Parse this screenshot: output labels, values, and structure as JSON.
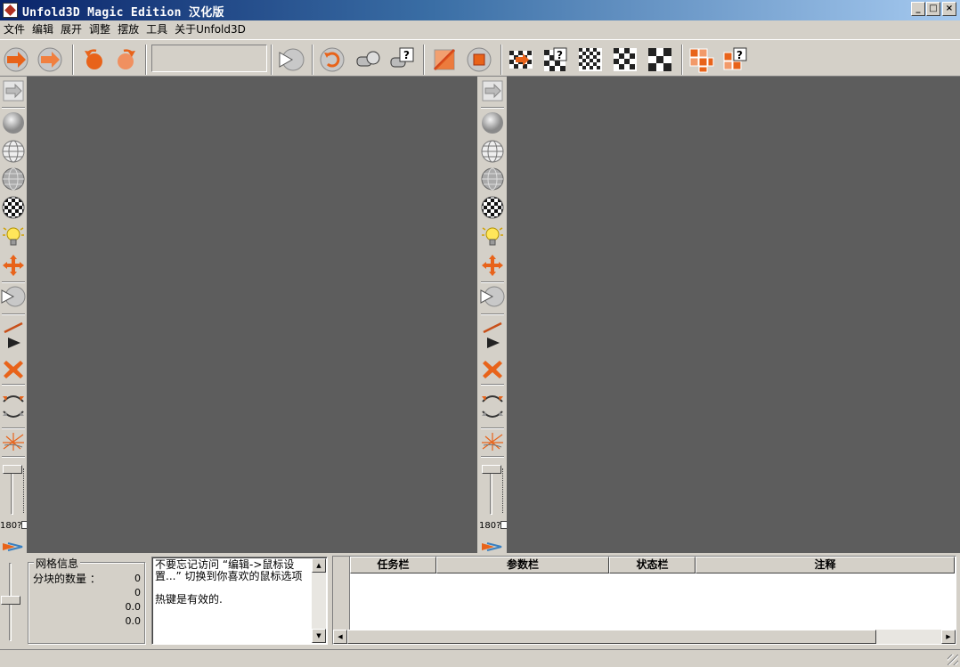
{
  "window": {
    "title": "Unfold3D Magic Edition 汉化版",
    "minimize_glyph": "_",
    "maximize_glyph": "□",
    "close_glyph": "×"
  },
  "menu": [
    "文件",
    "编辑",
    "展开",
    "调整",
    "摆放",
    "工具",
    "关于Unfold3D"
  ],
  "toolbar_icons": [
    "arrow-right-icon",
    "arrow-right-alt-icon",
    "rotate-left-icon",
    "rotate-right-icon",
    "cut-shape-icon",
    "undo-spiral-icon",
    "camera-icon",
    "help-camera-icon",
    "diagonal-square-icon",
    "stop-square-icon",
    "checker-arrow-icon",
    "checker-help-icon",
    "checker-small-icon",
    "checker-medium-icon",
    "checker-large-icon",
    "blocks-icon",
    "blocks-help-icon"
  ],
  "side_tools": {
    "angle_label": "180?",
    "icons": [
      "arrow-panel-icon",
      "sphere-icon",
      "wire-globe-icon",
      "globe-icon",
      "checker-sphere-icon",
      "light-bulb-icon",
      "move-cross-icon",
      "camera-cut-icon",
      "line-icon",
      "triangle-icon",
      "delete-x-icon",
      "relax-up-icon",
      "relax-down-icon",
      "spark-icon"
    ]
  },
  "mesh_info": {
    "title": "网格信息",
    "rows": [
      {
        "label": "分块的数量 ：",
        "value": "0"
      },
      {
        "label": "",
        "value": "0"
      },
      {
        "label": "",
        "value": "0.0"
      },
      {
        "label": "",
        "value": "0.0"
      }
    ]
  },
  "message": {
    "text": "不要忘记访问 “编辑->鼠标设置...” 切换到你喜欢的鼠标选项\n\n热键是有效的."
  },
  "task_grid": {
    "columns": [
      "任务栏",
      "参数栏",
      "状态栏",
      "注释"
    ]
  },
  "colors": {
    "viewport_bg": "#5d5d5d",
    "accent_orange": "#e8631a",
    "titlebar_start": "#0a246a",
    "titlebar_end": "#a6caf0"
  }
}
